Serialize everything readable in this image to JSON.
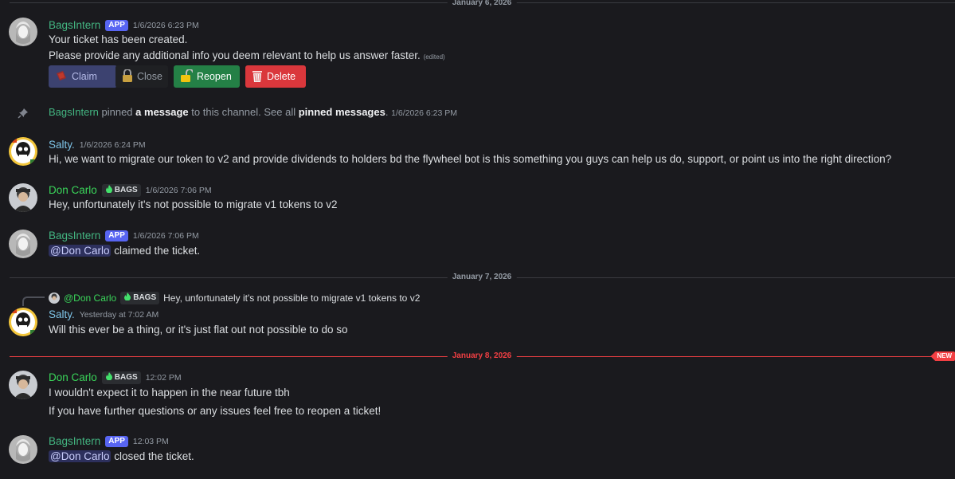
{
  "dividers": [
    {
      "label": "January 6, 2026"
    },
    {
      "label": "January 7, 2026"
    },
    {
      "label": "January 8, 2026",
      "new_badge": "NEW"
    }
  ],
  "messages": {
    "m1": {
      "author": "BagsIntern",
      "tag": "APP",
      "time": "1/6/2026 6:23 PM",
      "line1": "Your ticket has been created.",
      "line2": "Please provide any additional info you deem relevant to help us answer faster.",
      "edited": "(edited)",
      "buttons": {
        "claim": "Claim",
        "close": "Close",
        "reopen": "Reopen",
        "delete": "Delete"
      }
    },
    "pin": {
      "author": "BagsIntern",
      "text1": "pinned",
      "link1": "a message",
      "text2": "to this channel. See all",
      "link2": "pinned messages",
      "text3": ".",
      "time": "1/6/2026 6:23 PM"
    },
    "m2": {
      "author": "Salty.",
      "time": "1/6/2026 6:24 PM",
      "text": "Hi, we want to migrate our token to v2 and provide dividends to holders bd the flywheel bot is this something you guys can help us do, support, or point us into the right direction?"
    },
    "m3": {
      "author": "Don Carlo",
      "tag": "BAGS",
      "time": "1/6/2026 7:06 PM",
      "text": "Hey, unfortunately it's not possible to migrate v1 tokens to v2"
    },
    "m4": {
      "author": "BagsIntern",
      "tag": "APP",
      "time": "1/6/2026 7:06 PM",
      "mention": "@Don Carlo",
      "text": "claimed the ticket."
    },
    "m5": {
      "reply_author": "@Don Carlo",
      "reply_tag": "BAGS",
      "reply_text": "Hey, unfortunately it's not possible to migrate v1 tokens to v2",
      "author": "Salty.",
      "time": "Yesterday at 7:02 AM",
      "text": "Will this ever be a thing, or it's just flat out not possible to do so"
    },
    "m6": {
      "author": "Don Carlo",
      "tag": "BAGS",
      "time": "12:02 PM",
      "line1": "I wouldn't expect it to happen in the near future tbh",
      "line2": "If you have further questions or any issues feel free to reopen a ticket!"
    },
    "m7": {
      "author": "BagsIntern",
      "tag": "APP",
      "time": "12:03 PM",
      "mention": "@Don Carlo",
      "text": "closed the ticket."
    }
  },
  "colors": {
    "background": "#1a1a1e",
    "bot_name": "#43b581",
    "don_name": "#3ad65a",
    "salty_name": "#7ec3e6",
    "app_tag": "#5865f2",
    "new_divider": "#f23f43"
  },
  "icons": [
    "pin-icon",
    "lock-open-icon",
    "lock-icon",
    "trash-icon",
    "ticket-icon",
    "flame-icon"
  ]
}
